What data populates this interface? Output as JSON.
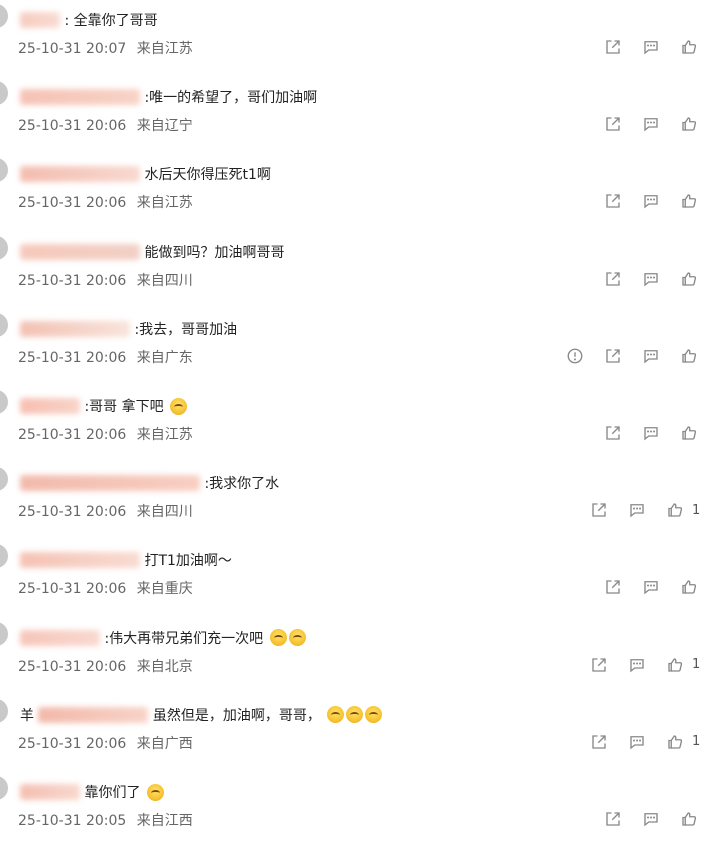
{
  "comments": [
    {
      "nick_colors": [
        "#f6c3b4",
        "#f7d6cc"
      ],
      "text": ": 全靠你了哥哥",
      "time": "25-10-31 20:07",
      "loc": "来自江苏",
      "report": false,
      "likes": ""
    },
    {
      "nick_colors": [
        "#f4b8a8",
        "#f6cbbd"
      ],
      "text": ":唯一的希望了，哥们加油啊",
      "time": "25-10-31 20:06",
      "loc": "来自辽宁",
      "report": false,
      "likes": ""
    },
    {
      "nick_colors": [
        "#f2b2a2",
        "#f6d2c8"
      ],
      "text": "水后天你得压死t1啊",
      "time": "25-10-31 20:06",
      "loc": "来自江苏",
      "report": false,
      "likes": ""
    },
    {
      "nick_colors": [
        "#f4c0b0",
        "#efc8bc"
      ],
      "text": "能做到吗？加油啊哥哥",
      "time": "25-10-31 20:06",
      "loc": "来自四川",
      "report": false,
      "likes": ""
    },
    {
      "nick_colors": [
        "#f0b7a6",
        "#f7dfd6"
      ],
      "text": ":我去，哥哥加油",
      "time": "25-10-31 20:06",
      "loc": "来自广东",
      "report": true,
      "likes": ""
    },
    {
      "nick_colors": [
        "#f6b4a4",
        "#f6ccbf"
      ],
      "text": ":哥哥  拿下吧",
      "time": "25-10-31 20:06",
      "loc": "来自江苏",
      "report": false,
      "likes": "",
      "emojis": [
        "😭"
      ]
    },
    {
      "nick_colors": [
        "#f0ae9d",
        "#f6c7b9"
      ],
      "text": ":我求你了水",
      "time": "25-10-31 20:06",
      "loc": "来自四川",
      "report": false,
      "likes": "1"
    },
    {
      "nick_colors": [
        "#f3b8a7",
        "#f7d5ca"
      ],
      "text": "打T1加油啊～",
      "time": "25-10-31 20:06",
      "loc": "来自重庆",
      "report": false,
      "likes": ""
    },
    {
      "nick_colors": [
        "#f5bcae",
        "#f7d2c7"
      ],
      "text": ":伟大再带兄弟们充一次吧",
      "time": "25-10-31 20:06",
      "loc": "来自北京",
      "report": false,
      "likes": "1",
      "emojis": [
        "😭",
        "😭"
      ]
    },
    {
      "nick_colors": [
        "#f0ad9b",
        "#f7cbbe"
      ],
      "text": "虽然但是，加油啊，哥哥，",
      "time": "25-10-31 20:06",
      "loc": "来自广西",
      "report": false,
      "likes": "1",
      "emojis": [
        "😭",
        "😭",
        "😭"
      ],
      "prefix": "羊"
    },
    {
      "nick_colors": [
        "#f2b4a4",
        "#f7d2c6"
      ],
      "text": "靠你们了",
      "time": "25-10-31 20:05",
      "loc": "来自江西",
      "report": false,
      "likes": "",
      "emojis": [
        "😭"
      ]
    }
  ],
  "icons": {
    "report": "report-icon",
    "share": "share-icon",
    "reply": "comment-icon",
    "like": "like-icon"
  }
}
